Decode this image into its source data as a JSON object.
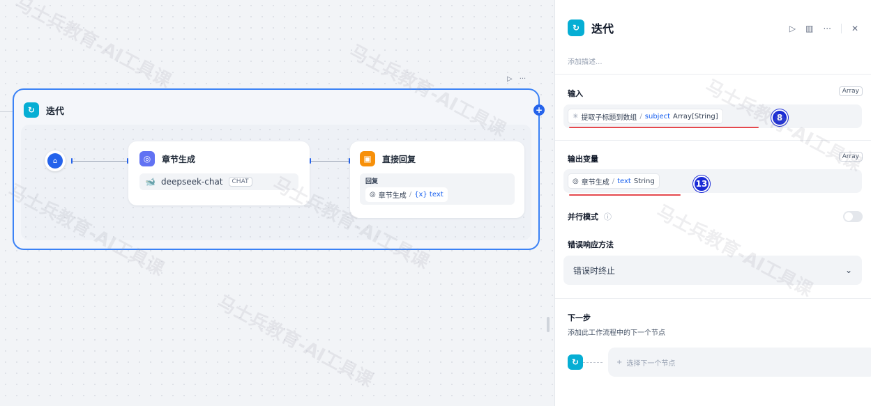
{
  "canvas": {
    "mini_toolbar": {
      "run_icon": "play-icon",
      "more_icon": "more-icon"
    },
    "iteration_node": {
      "title": "迭代",
      "icon": "iteration-icon",
      "start_icon": "home-icon",
      "llm_node": {
        "title": "章节生成",
        "model": "deepseek-chat",
        "model_badge": "CHAT",
        "icon": "llm-icon"
      },
      "answer_node": {
        "title": "直接回复",
        "reply_label": "回复",
        "var_source": "章节生成",
        "var_sep": "/",
        "var_name": "{x} text",
        "icon": "answer-icon"
      }
    }
  },
  "panel": {
    "title": "迭代",
    "description_placeholder": "添加描述...",
    "input": {
      "label": "输入",
      "type": "Array",
      "source": "提取子标题到数组",
      "sep": "/",
      "var": "subject",
      "var_type": "Array[String]",
      "badge": "8"
    },
    "output": {
      "label": "输出变量",
      "type": "Array",
      "source": "章节生成",
      "sep": "/",
      "var": "text",
      "var_type": "String",
      "badge": "13"
    },
    "parallel": {
      "label": "并行模式"
    },
    "error": {
      "label": "错误响应方法",
      "value": "错误时终止"
    },
    "next": {
      "label": "下一步",
      "description": "添加此工作流程中的下一个节点",
      "select_placeholder": "选择下一个节点"
    }
  },
  "watermark_text": "马士兵教育-AI工具课",
  "colors": {
    "accent": "#2563eb",
    "node_border": "#3b82f6",
    "annotation_red": "#e5484d",
    "badge_blue": "#1a2bd6"
  }
}
